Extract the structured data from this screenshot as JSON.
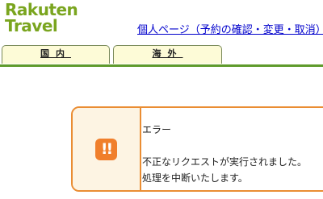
{
  "header": {
    "logo_line1": "Rakuten",
    "logo_line2": "Travel",
    "mypage_link": "個人ページ（予約の確認・変更・取消）"
  },
  "tabs": [
    {
      "label": "国内"
    },
    {
      "label": "海外"
    }
  ],
  "error": {
    "title": "エラー",
    "icon": "exclamation-icon",
    "message_line1": "不正なリクエストが実行されました。",
    "message_line2": "処理を中断いたします。"
  },
  "colors": {
    "brand_green": "#7aa51f",
    "tab_border_green": "#5f9b2c",
    "error_orange": "#ea8d33",
    "link_blue": "#0000cc"
  }
}
